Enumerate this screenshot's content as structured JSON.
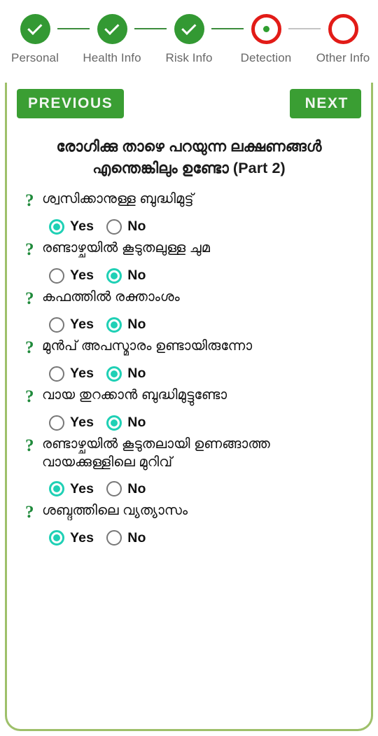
{
  "stepper": {
    "steps": [
      {
        "label": "Personal",
        "state": "done"
      },
      {
        "label": "Health Info",
        "state": "done"
      },
      {
        "label": "Risk Info",
        "state": "done"
      },
      {
        "label": "Detection",
        "state": "active"
      },
      {
        "label": "Other Info",
        "state": "todo"
      }
    ],
    "colors": {
      "done": "#339933",
      "active_ring": "#e21b17",
      "active_dot": "#2f9e2f",
      "connector_done": "#3c8c3c",
      "connector_todo": "#c4c4c4",
      "label": "#686868"
    }
  },
  "nav": {
    "previous_label": "PREVIOUS",
    "next_label": "NEXT",
    "button_color": "#3a9e33"
  },
  "form": {
    "title": "രോഗിക്കു താഴെ പറയുന്ന ലക്ഷണങ്ങൾ എന്തെങ്കിലും ഉണ്ടോ (Part 2)",
    "yes_label": "Yes",
    "no_label": "No",
    "selected_color": "#1fd0b5",
    "question_icon": "question-mark-icon",
    "questions": [
      {
        "text": "ശ്വസിക്കാനുള്ള ബുദ്ധിമുട്ട്",
        "answer": "Yes"
      },
      {
        "text": "രണ്ടാഴ്ചയില്‍ കൂടുതലുള്ള ചുമ",
        "answer": "No"
      },
      {
        "text": "കഫത്തില്‍ രക്താംശം",
        "answer": "No"
      },
      {
        "text": "മുൻപ് അപസ്മാരം ഉണ്ടായിരുന്നോ",
        "answer": "No"
      },
      {
        "text": "വായ തുറക്കാൻ ബുദ്ധിമുട്ടുണ്ടോ",
        "answer": "No"
      },
      {
        "text": "രണ്ടാഴ്ചയില്‍ കൂടുതലായി ഉണങ്ങാത്ത വായക്കുള്ളിലെ മുറിവ്",
        "answer": "Yes"
      },
      {
        "text": "ശബ്ദത്തിലെ വ്യത്യാസം",
        "answer": "Yes"
      }
    ]
  }
}
